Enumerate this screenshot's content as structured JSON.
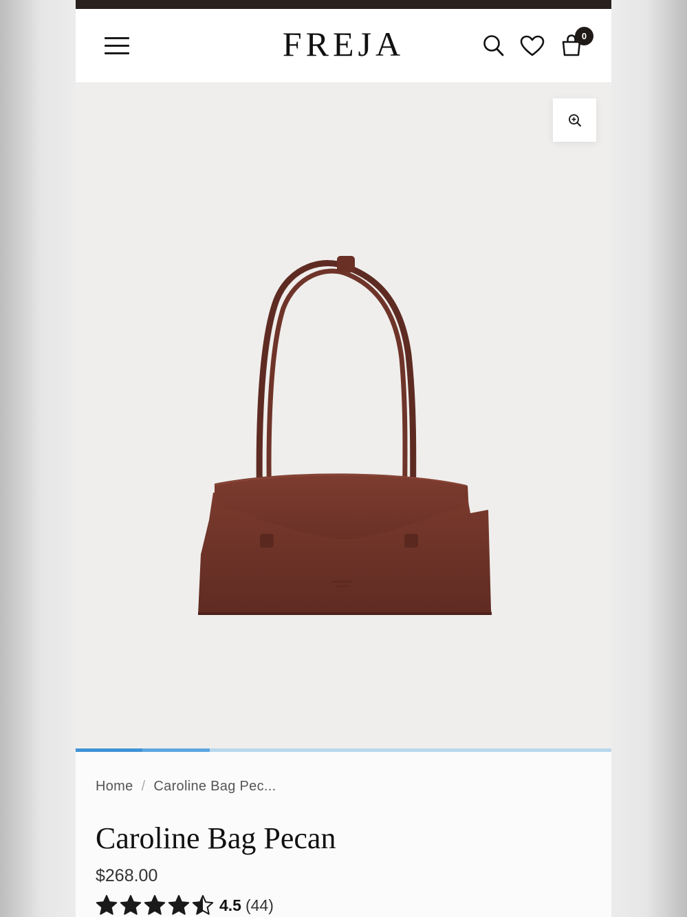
{
  "header": {
    "logo": "FREJA",
    "cart_count": "0",
    "icons": [
      "menu-icon",
      "search-icon",
      "heart-icon",
      "shopping-bag-icon"
    ]
  },
  "gallery": {
    "zoom_icon": "zoom-in-icon",
    "slide_count": 8,
    "active_slide_fraction": 0.125
  },
  "breadcrumb": {
    "home": "Home",
    "separator": "/",
    "current": "Caroline Bag Pec..."
  },
  "product": {
    "title": "Caroline Bag Pecan",
    "price": "$268.00",
    "rating": 4.5,
    "rating_label": "4.5",
    "review_count": "(44)"
  },
  "colors": {
    "top_bar": "#2a201d",
    "bag_leather": "#6e3328",
    "slider_active": "#3f92d6",
    "slider_inactive": "#b8d8ee",
    "star": "#1a1a1a"
  }
}
